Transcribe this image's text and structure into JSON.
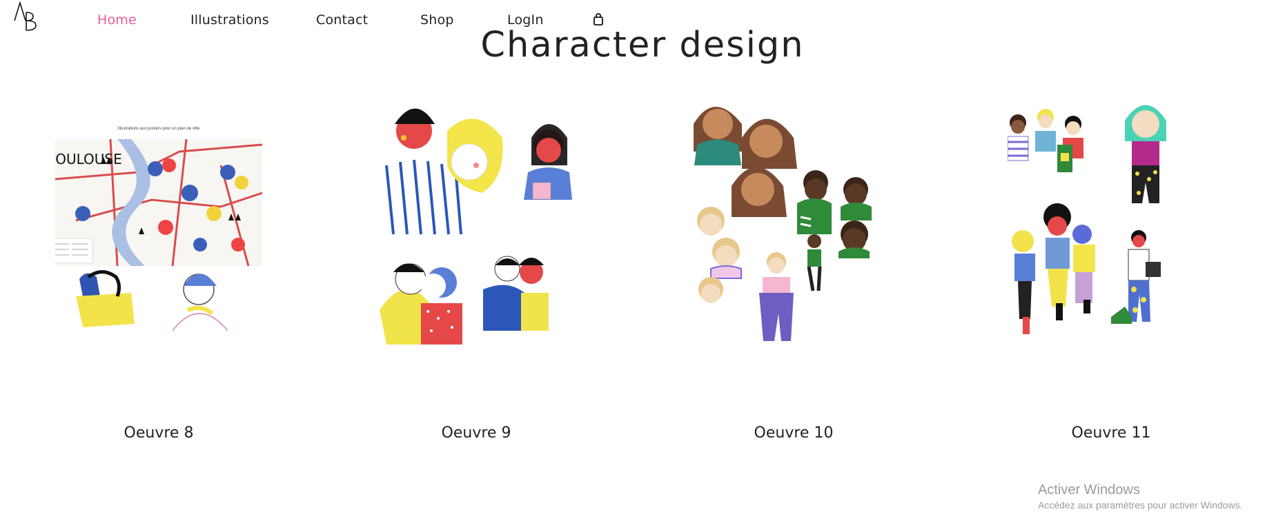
{
  "logo": {
    "text": "AB"
  },
  "nav": {
    "items": [
      {
        "label": "Home",
        "active": true
      },
      {
        "label": "Illustrations",
        "active": false
      },
      {
        "label": "Contact",
        "active": false
      },
      {
        "label": "Shop",
        "active": false
      },
      {
        "label": "LogIn",
        "active": false
      }
    ],
    "cart_icon": "shopping-bag-icon",
    "active_color": "#e85c9a"
  },
  "page": {
    "title": "Character design"
  },
  "gallery": {
    "items": [
      {
        "title": "Oeuvre 8",
        "map_title": "TOULOUSE",
        "map_caption": "Illustrations aux posters pour un plan de ville"
      },
      {
        "title": "Oeuvre 9"
      },
      {
        "title": "Oeuvre 10"
      },
      {
        "title": "Oeuvre 11"
      }
    ]
  },
  "watermark": {
    "title": "Activer Windows",
    "subtitle": "Accédez aux paramètres pour activer Windows."
  }
}
